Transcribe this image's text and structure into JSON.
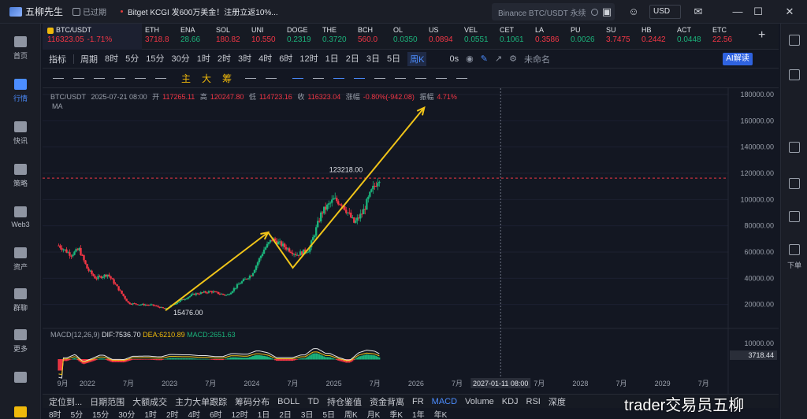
{
  "app": {
    "name": "五柳先生",
    "expired": "已过期"
  },
  "news": {
    "text": "Bitget KCGI 发600万美金！注册立返10%..."
  },
  "search": {
    "placeholder": "Binance BTC/USDT 永续"
  },
  "currency": "USD",
  "left_sidebar": [
    {
      "label": "首页"
    },
    {
      "label": "行情"
    },
    {
      "label": "快讯"
    },
    {
      "label": "策略"
    },
    {
      "label": "Web3"
    },
    {
      "label": "资产"
    },
    {
      "label": "群聊"
    },
    {
      "label": "更多"
    }
  ],
  "right_sidebar": {
    "download_label": "下单"
  },
  "tickers": [
    {
      "name": "BTC/USDT",
      "value": "116323.05",
      "change": "-1.71%",
      "dir": "down"
    },
    {
      "name": "ETH",
      "value": "3718.8",
      "dir": "down"
    },
    {
      "name": "ENA",
      "value": "28.66",
      "dir": "up"
    },
    {
      "name": "SOL",
      "value": "180.82",
      "dir": "down"
    },
    {
      "name": "UNI",
      "value": "10.550",
      "dir": "down"
    },
    {
      "name": "DOGE",
      "value": "0.2319",
      "dir": "up"
    },
    {
      "name": "THE",
      "value": "0.3720",
      "dir": "up"
    },
    {
      "name": "BCH",
      "value": "560.0",
      "dir": "down"
    },
    {
      "name": "OL",
      "value": "0.0350",
      "dir": "up"
    },
    {
      "name": "US",
      "value": "0.0894",
      "dir": "down"
    },
    {
      "name": "VEL",
      "value": "0.0551",
      "dir": "up"
    },
    {
      "name": "CET",
      "value": "0.1061",
      "dir": "up"
    },
    {
      "name": "LA",
      "value": "0.3586",
      "dir": "down"
    },
    {
      "name": "PU",
      "value": "0.0026",
      "dir": "up"
    },
    {
      "name": "SU",
      "value": "3.7475",
      "dir": "down"
    },
    {
      "name": "HB",
      "value": "0.2442",
      "dir": "down"
    },
    {
      "name": "ACT",
      "value": "0.0448",
      "dir": "up"
    },
    {
      "name": "ETC",
      "value": "22.56",
      "dir": "down"
    }
  ],
  "period_toolbar": {
    "indicators": "指标",
    "period": "周期",
    "periods": [
      "8时",
      "5分",
      "15分",
      "30分",
      "1时",
      "2时",
      "3时",
      "4时",
      "6时",
      "12时",
      "1日",
      "2日",
      "3日",
      "5日",
      "周K"
    ],
    "selected": "周K",
    "right": [
      "0s"
    ],
    "layout_name": "未命名",
    "ai": "AI解读"
  },
  "draw_tools": {
    "labels": [
      "主",
      "大",
      "筹"
    ]
  },
  "chart_legend": {
    "symbol": "BTC/USDT",
    "date": "2025-07-21 08:00",
    "open_label": "开",
    "open": "117265.11",
    "high_label": "高",
    "high": "120247.80",
    "low_label": "低",
    "low": "114723.16",
    "close_label": "收",
    "close": "116323.04",
    "chg_label": "涨幅",
    "chg": "-0.80%(-942.08)",
    "amp_label": "振幅",
    "amp": "4.71%",
    "ma": "MA"
  },
  "chart_data": {
    "type": "candlestick",
    "y_ticks": [
      "180000.00",
      "160000.00",
      "140000.00",
      "120000.00",
      "100000.00",
      "80000.00",
      "60000.00",
      "40000.00",
      "20000.00"
    ],
    "x_ticks": [
      "9月",
      "2022",
      "7月",
      "2023",
      "7月",
      "2024",
      "7月",
      "2025",
      "7月",
      "2026",
      "7月",
      "2027",
      "7月",
      "2028",
      "7月",
      "2029",
      "7月"
    ],
    "ylim": [
      0,
      180000
    ],
    "high_label": "123218.00",
    "low_label": "15476.00",
    "current_price": "116323.05",
    "crosshair_date": "2027-01-11 08:00",
    "macd_price_tick": "10000.00",
    "macd_marker": "3718.44",
    "trend_points": [
      [
        2022.95,
        15476
      ],
      [
        2024.2,
        75000
      ],
      [
        2024.5,
        48000
      ],
      [
        2026.1,
        170000
      ]
    ]
  },
  "macd_legend": {
    "name": "MACD(12,26,9)",
    "dif": "DIF:7536.70",
    "dea": "DEA:6210.89",
    "macd": "MACD:2651.63"
  },
  "bottom_bar": {
    "items": [
      "定位到...",
      "日期范围",
      "大额成交",
      "主力大单跟踪",
      "筹码分布",
      "BOLL",
      "TD",
      "持仓鉴值",
      "资金背离",
      "FR",
      "MACD",
      "Volume",
      "KDJ",
      "RSI",
      "深度"
    ],
    "selected": "MACD",
    "sub": [
      "8时",
      "5分",
      "15分",
      "30分",
      "1时",
      "2时",
      "4时",
      "6时",
      "12时",
      "1日",
      "2日",
      "3日",
      "5日",
      "周K",
      "月K",
      "季K",
      "1年",
      "年K"
    ]
  },
  "watermark": "trader交易员五柳"
}
